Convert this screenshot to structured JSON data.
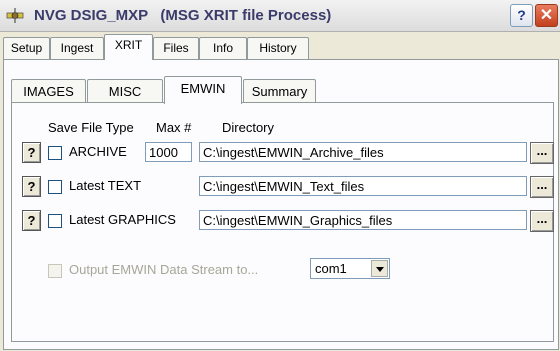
{
  "window": {
    "title": "NVG DSIG_MXP   (MSG XRIT file Process)",
    "help_label": "?",
    "close_label": "✕"
  },
  "tabs": {
    "top": [
      "Setup",
      "Ingest",
      "XRIT",
      "Files",
      "Info",
      "History"
    ],
    "top_active": "XRIT",
    "sub": [
      "IMAGES",
      "MISC",
      "EMWIN",
      "Summary"
    ],
    "sub_active": "EMWIN"
  },
  "emwin": {
    "headers": {
      "save_file_type": "Save File Type",
      "max": "Max #",
      "directory": "Directory"
    },
    "rows": [
      {
        "help": "?",
        "label": "ARCHIVE",
        "max": "1000",
        "directory": "C:\\ingest\\EMWIN_Archive_files",
        "browse": "...",
        "checked": false
      },
      {
        "help": "?",
        "label": "Latest TEXT",
        "directory": "C:\\ingest\\EMWIN_Text_files",
        "browse": "...",
        "checked": false
      },
      {
        "help": "?",
        "label": "Latest GRAPHICS",
        "directory": "C:\\ingest\\EMWIN_Graphics_files",
        "browse": "...",
        "checked": false
      }
    ],
    "output_stream": {
      "label": "Output EMWIN Data Stream to...",
      "port": "com1",
      "enabled": false
    }
  }
}
